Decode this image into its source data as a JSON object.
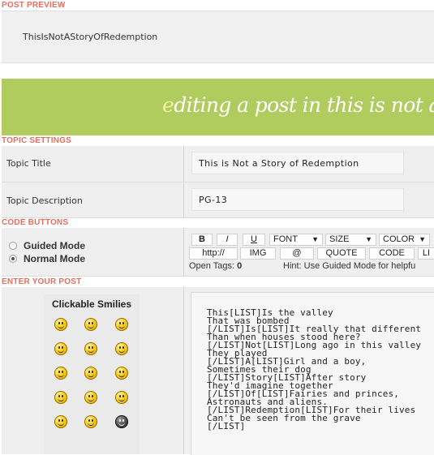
{
  "sections": {
    "post_preview": "POST PREVIEW",
    "topic_settings": "TOPIC SETTINGS",
    "code_buttons": "CODE BUTTONS",
    "enter_post": "ENTER YOUR POST"
  },
  "preview": {
    "text": "ThisIsNotAStoryOfRedemption"
  },
  "banner": {
    "first_letter": "e",
    "rest": "diting a post in this is not a sto"
  },
  "topic": {
    "title_label": "Topic Title",
    "title_value": "This is Not a Story of Redemption",
    "description_label": "Topic Description",
    "description_value": "PG-13"
  },
  "mode": {
    "guided": "Guided Mode",
    "normal": "Normal Mode",
    "selected": "normal"
  },
  "toolbar": {
    "bold": "B",
    "italic": "I",
    "underline": "U",
    "font": "FONT",
    "size": "SIZE",
    "color": "COLOR",
    "http": "http://",
    "img": "IMG",
    "at": "@",
    "quote": "QUOTE",
    "code": "CODE",
    "list": "LI",
    "open_tags_label": "Open Tags:",
    "open_tags_count": "0",
    "hint": "Hint: Use Guided Mode for helpfu"
  },
  "smilies": {
    "title": "Clickable Smilies",
    "icons": [
      "smile-icon",
      "shocked-icon",
      "wink-icon",
      "tongue-icon",
      "grin-icon",
      "big-grin-icon",
      "cool-icon",
      "laugh-icon",
      "dry-icon",
      "happy-icon",
      "angry-icon",
      "sad-icon",
      "blink-icon",
      "rolleyes-icon",
      "ninja-icon"
    ]
  },
  "post": {
    "body": "This[LIST]Is the valley\nThat was bombed\n[/LIST]Is[LIST]It really that different\nThan when houses stood here?\n[/LIST]Not[LIST]Long ago in this valley\nThey played\n[/LIST]A[LIST]Girl and a boy,\nSometimes their dog\n[/LIST]Story[LIST]After story\nThey'd imagine together\n[/LIST]Of[LIST]Fairies and princes,\nAstronauts and aliens.\n[/LIST]Redemption[LIST]For their lives\nCan't be seen from the grave\n[/LIST]"
  },
  "colors": {
    "section_label": "#e46f61",
    "banner_bg": "#b1cc5e",
    "banner_text": "#ffffff"
  }
}
